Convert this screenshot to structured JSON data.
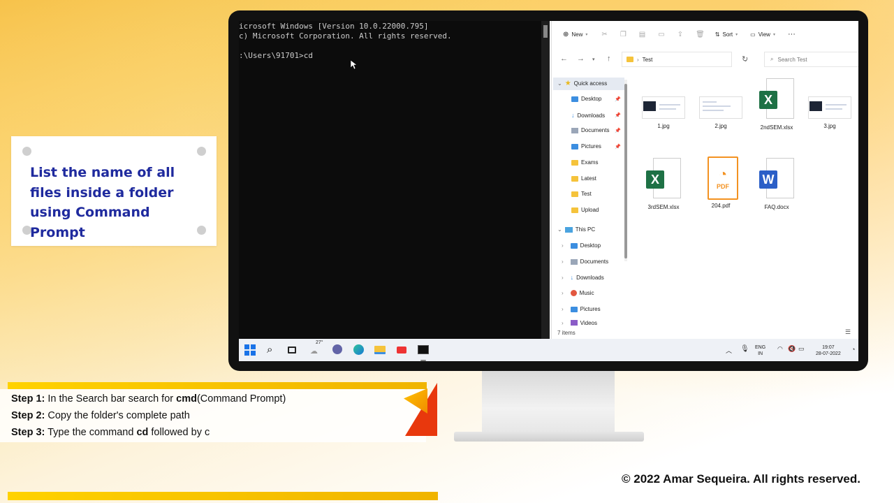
{
  "title_card": {
    "text": "List the name of all files inside a folder using Command Prompt"
  },
  "cmd": {
    "lines": [
      "icrosoft Windows [Version 10.0.22000.795]",
      "c) Microsoft Corporation. All rights reserved.",
      "",
      ":\\Users\\91701>cd"
    ]
  },
  "explorer": {
    "toolbar": {
      "new_label": "New",
      "sort_label": "Sort",
      "view_label": "View",
      "more_label": "···"
    },
    "address": {
      "path": "Test",
      "search_placeholder": "Search Test"
    },
    "sidebar": {
      "quick_access": "Quick access",
      "qa_items": [
        "Desktop",
        "Downloads",
        "Documents",
        "Pictures",
        "Exams",
        "Latest",
        "Test",
        "Upload"
      ],
      "this_pc": "This PC",
      "pc_items": [
        "Desktop",
        "Documents",
        "Downloads",
        "Music",
        "Pictures",
        "Videos"
      ]
    },
    "files": [
      {
        "name": "1.jpg",
        "kind": "image-dark"
      },
      {
        "name": "2.jpg",
        "kind": "image-light"
      },
      {
        "name": "2ndSEM.xlsx",
        "kind": "excel"
      },
      {
        "name": "3.jpg",
        "kind": "image-dark"
      },
      {
        "name": "3rdSEM.xlsx",
        "kind": "excel"
      },
      {
        "name": "204.pdf",
        "kind": "pdf"
      },
      {
        "name": "FAQ.docx",
        "kind": "word"
      }
    ],
    "status": "7 items",
    "colors": {
      "excel": "#1e7145",
      "word": "#2b5fc7",
      "pdf": "#f39221",
      "folder": "#f5c33b"
    }
  },
  "taskbar": {
    "weather": "27°",
    "lang_line1": "ENG",
    "lang_line2": "IN",
    "time": "19:07",
    "date": "28-07-2022"
  },
  "steps": [
    {
      "label": "Step 1:",
      "text_before": " In the Search bar search for ",
      "bold": "cmd",
      "text_after": "(Command Prompt)"
    },
    {
      "label": "Step 2:",
      "text_before": " Copy the folder's complete path",
      "bold": "",
      "text_after": ""
    },
    {
      "label": "Step 3:",
      "text_before": " Type the command ",
      "bold": "cd",
      "text_after": " followed by c"
    }
  ],
  "copyright": "© 2022 Amar Sequeira. All rights reserved."
}
